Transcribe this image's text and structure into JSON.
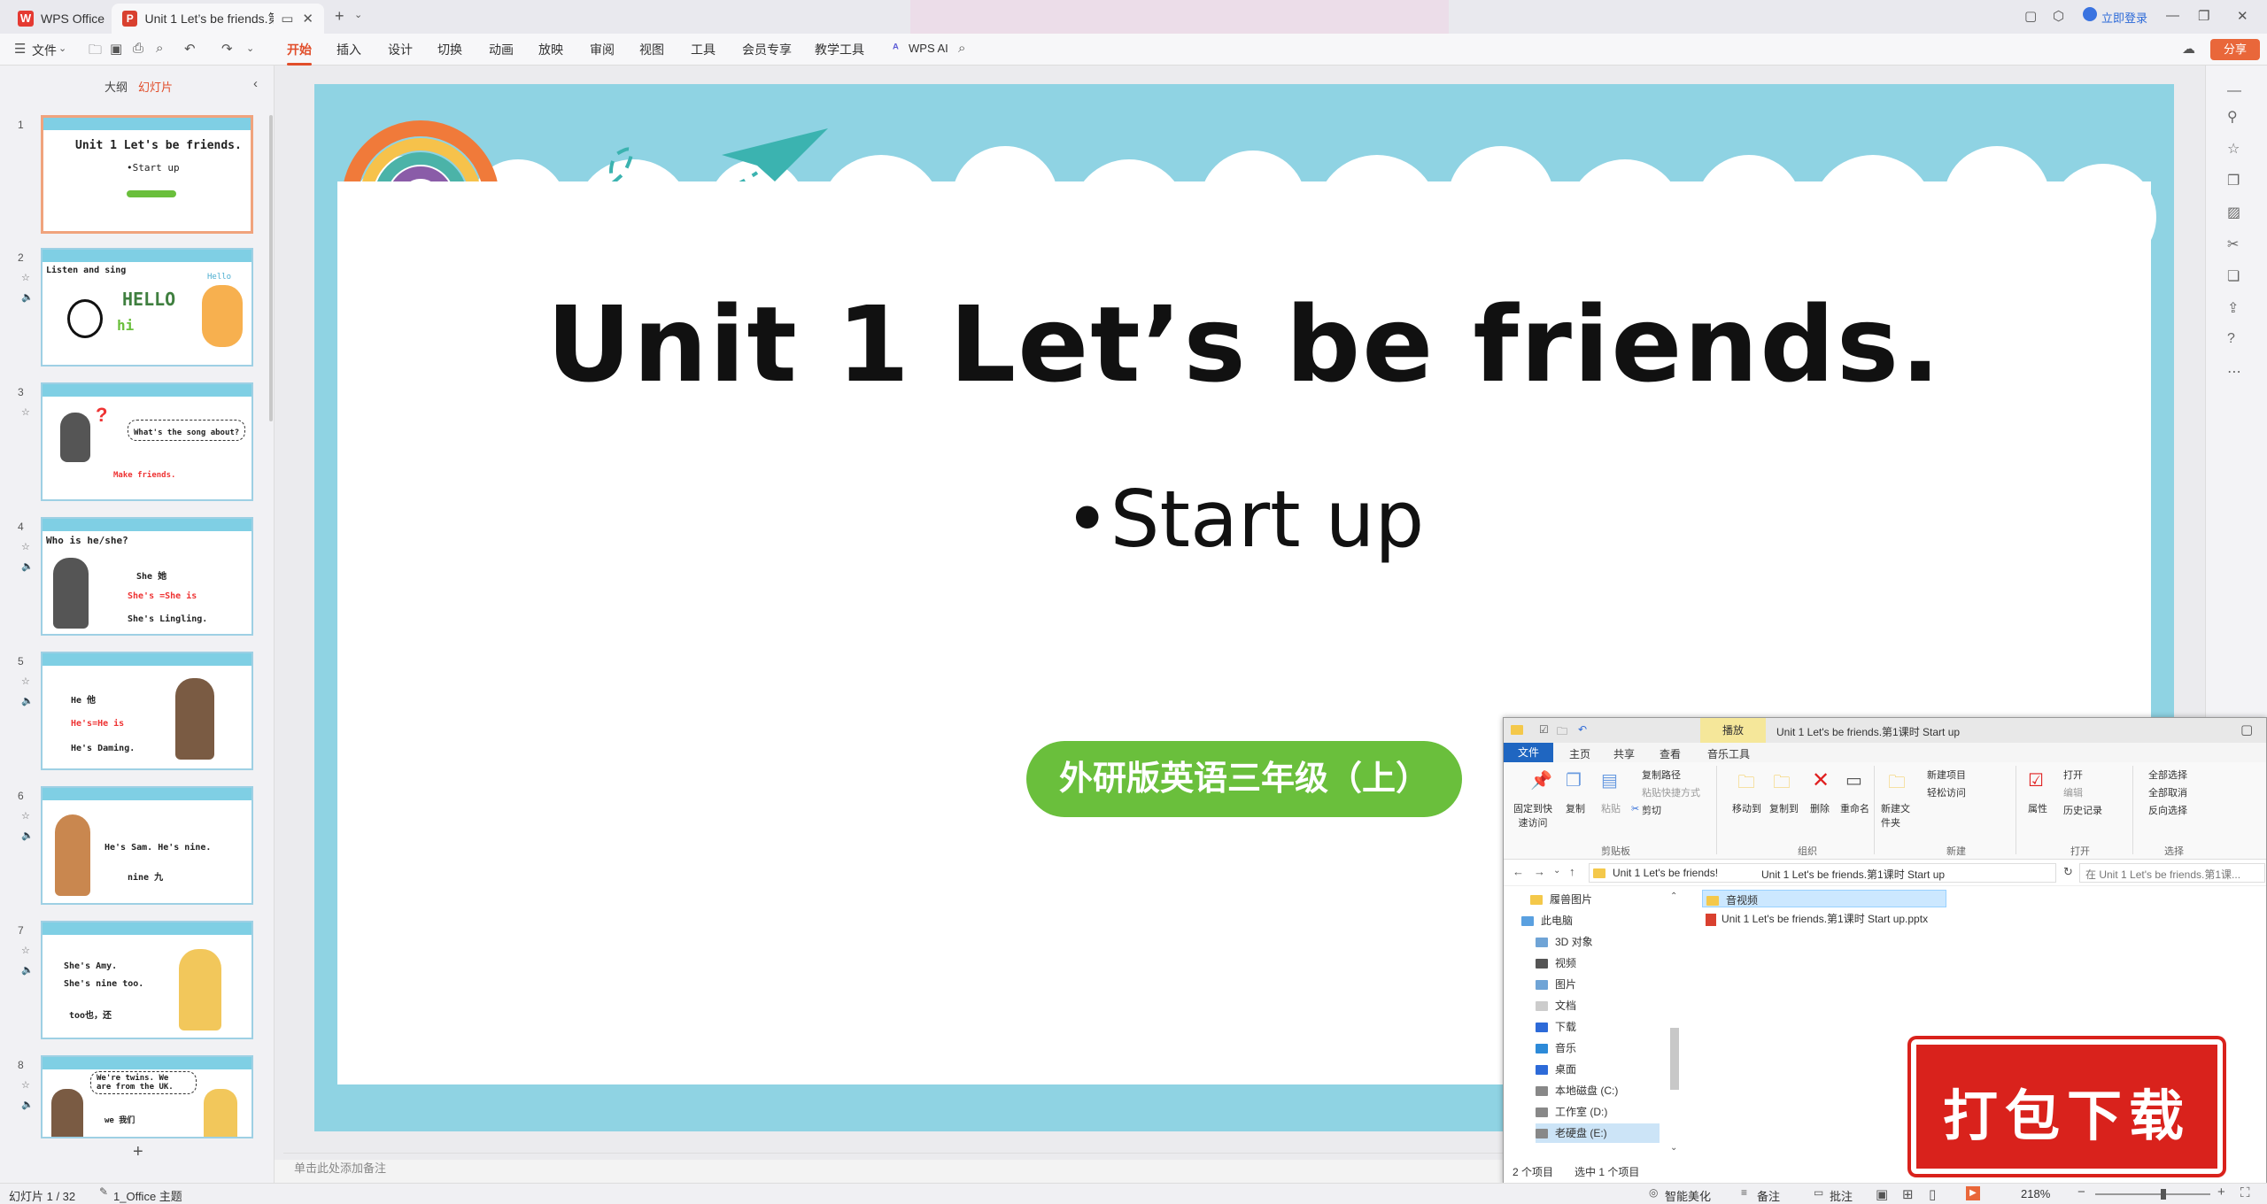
{
  "titlebar": {
    "app_tab": "WPS Office",
    "doc_tab": "Unit 1  Let’s be friends.第1",
    "login": "立即登录"
  },
  "ribbon": {
    "file_menu": "文件",
    "tabs": [
      "开始",
      "插入",
      "设计",
      "切换",
      "动画",
      "放映",
      "审阅",
      "视图",
      "工具",
      "会员专享",
      "教学工具"
    ],
    "active_tab": "开始",
    "ai": "WPS AI",
    "share": "分享"
  },
  "left_panel": {
    "tab_outline": "大纲",
    "tab_slides": "幻灯片",
    "slides": [
      {
        "num": "1",
        "line1": "Unit 1  Let's be friends.",
        "line2": "•Start up"
      },
      {
        "num": "2",
        "line1": "Listen and sing",
        "line2": "HELLO",
        "line3": "hi",
        "line4": "Hello"
      },
      {
        "num": "3",
        "line1": "What's the song about?",
        "line2": "Make friends."
      },
      {
        "num": "4",
        "line1": "Who is he/she?",
        "line2": "She 她",
        "line3": "She's =She is",
        "line4": "She's Lingling."
      },
      {
        "num": "5",
        "line1": "He 他",
        "line2": "He's=He is",
        "line3": "He's Daming."
      },
      {
        "num": "6",
        "line1": "He's Sam.  He's nine.",
        "line2": "nine  九"
      },
      {
        "num": "7",
        "line1": "She's Amy.",
        "line2": "She's nine too.",
        "line3": "too也，还"
      },
      {
        "num": "8",
        "line1": "We're twins. We",
        "line2": "are from the UK.",
        "line3": "we 我们"
      }
    ]
  },
  "slide": {
    "title": "Unit 1  Let’s be friends.",
    "subtitle": "•Start up",
    "badge": "外研版英语三年级（上）"
  },
  "notes_placeholder": "单击此处添加备注",
  "statusbar": {
    "slide_count": "幻灯片 1 / 32",
    "theme": "1_Office 主题",
    "smart": "智能美化",
    "notes": "备注",
    "comments": "批注",
    "zoom": "218%"
  },
  "explorer": {
    "title": "Unit 1  Let's be friends.第1课时 Start up",
    "context_tab": "播放",
    "tabs": [
      "文件",
      "主页",
      "共享",
      "查看",
      "音乐工具"
    ],
    "ribbon": {
      "pin": "固定到快速访问",
      "copy": "复制",
      "paste": "粘贴",
      "copy_path": "复制路径",
      "paste_shortcut": "粘贴快捷方式",
      "cut": "剪切",
      "clipboard": "剪贴板",
      "move_to": "移动到",
      "copy_to": "复制到",
      "delete": "删除",
      "rename": "重命名",
      "organize": "组织",
      "new_folder": "新建文件夹",
      "new_item": "新建项目",
      "easy_access": "轻松访问",
      "new": "新建",
      "properties": "属性",
      "open": "打开",
      "edit": "编辑",
      "history": "历史记录",
      "open_group": "打开",
      "select_all": "全部选择",
      "select_none": "全部取消",
      "invert": "反向选择",
      "select": "选择"
    },
    "address": [
      "Unit 1 Let's be  friends!",
      "Unit 1  Let's be friends.第1课时 Start up"
    ],
    "search": "在 Unit 1  Let's be friends.第1课...",
    "nav": [
      "履兽图片",
      "此电脑",
      "3D 对象",
      "视频",
      "图片",
      "文档",
      "下载",
      "音乐",
      "桌面",
      "本地磁盘 (C:)",
      "工作室 (D:)",
      "老硬盘 (E:)"
    ],
    "files": [
      "音视频",
      "Unit 1  Let's be friends.第1课时 Start up.pptx"
    ],
    "status_count": "2 个项目",
    "status_selected": "选中 1 个项目"
  },
  "download_badge": "打包下载",
  "colors": {
    "accent": "#e14d2a",
    "slide_bg": "#8fd3e3",
    "badge_green": "#6abf3c",
    "download_red": "#d9221c"
  }
}
